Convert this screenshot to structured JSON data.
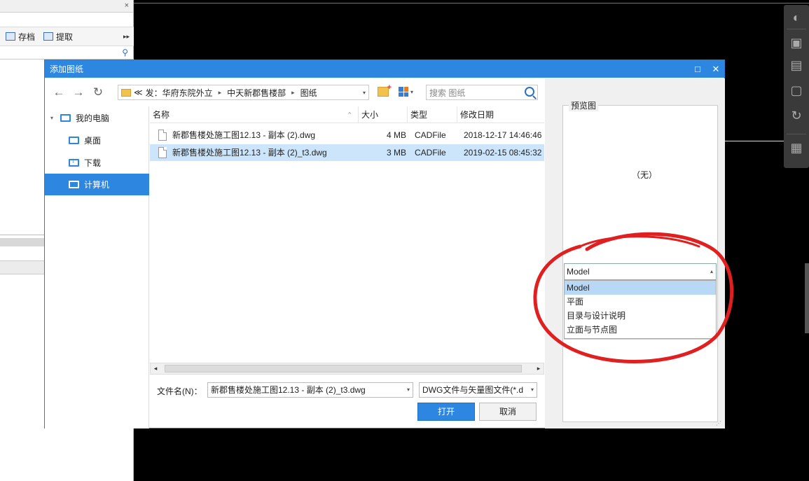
{
  "background_panel": {
    "close_glyph": "×",
    "toolbar": {
      "save_label": "存档",
      "extract_label": "提取",
      "more_glyph": "▸▸"
    },
    "search_glyph": "⚲"
  },
  "dialog": {
    "title": "添加图纸",
    "maximize_glyph": "□",
    "close_glyph": "✕",
    "nav": {
      "back": "←",
      "forward": "→",
      "refresh": "↻"
    },
    "address": {
      "prefix": "≪",
      "crumbs": [
        "发：华府东院外立",
        "中天新郡售楼部",
        "图纸"
      ],
      "separator": "▸",
      "dropdown": "▾"
    },
    "search_placeholder": "搜索 图纸",
    "tree": {
      "expand": "▾",
      "items": [
        {
          "label": "我的电脑"
        },
        {
          "label": "桌面"
        },
        {
          "label": "下载"
        },
        {
          "label": "计算机"
        }
      ]
    },
    "columns": {
      "name": "名称",
      "size": "大小",
      "type": "类型",
      "modified": "修改日期",
      "sort_glyph": "^"
    },
    "files": [
      {
        "name": "新郡售楼处施工图12.13 - 副本 (2).dwg",
        "size": "4 MB",
        "type": "CADFile",
        "modified": "2018-12-17 14:46:46"
      },
      {
        "name": "新郡售楼处施工图12.13 - 副本 (2)_t3.dwg",
        "size": "3 MB",
        "type": "CADFile",
        "modified": "2019-02-15 08:45:32"
      }
    ],
    "hscroll": {
      "left": "◂",
      "right": "▸"
    },
    "filename_label": "文件名(N)：",
    "filename_value": "新郡售楼处施工图12.13 - 副本 (2)_t3.dwg",
    "filetype_value": "DWG文件与矢量图文件(*.d",
    "dropdown_glyph": "▾",
    "open_label": "打开",
    "cancel_label": "取消",
    "preview": {
      "group_label": "预览图",
      "empty_text": "（无）",
      "layout_selected": "Model",
      "layout_dd": "▴",
      "layout_options": [
        "Model",
        "平面",
        "目录与设计说明",
        "立面与节点图"
      ],
      "grip": "⋰"
    }
  },
  "view_tools": {
    "icons": [
      "orbit-icon",
      "3d-cube-icon",
      "wireframe-cube-icon",
      "cube-icon",
      "rotate-icon",
      "grid-icon"
    ],
    "labels": [
      "◐",
      "▣",
      "▤",
      "▢",
      "↻",
      "▦"
    ]
  },
  "colors": {
    "accent": "#2d86e0",
    "selection": "#cde5fb",
    "annotation": "#e02020",
    "canvas": "#000000"
  }
}
